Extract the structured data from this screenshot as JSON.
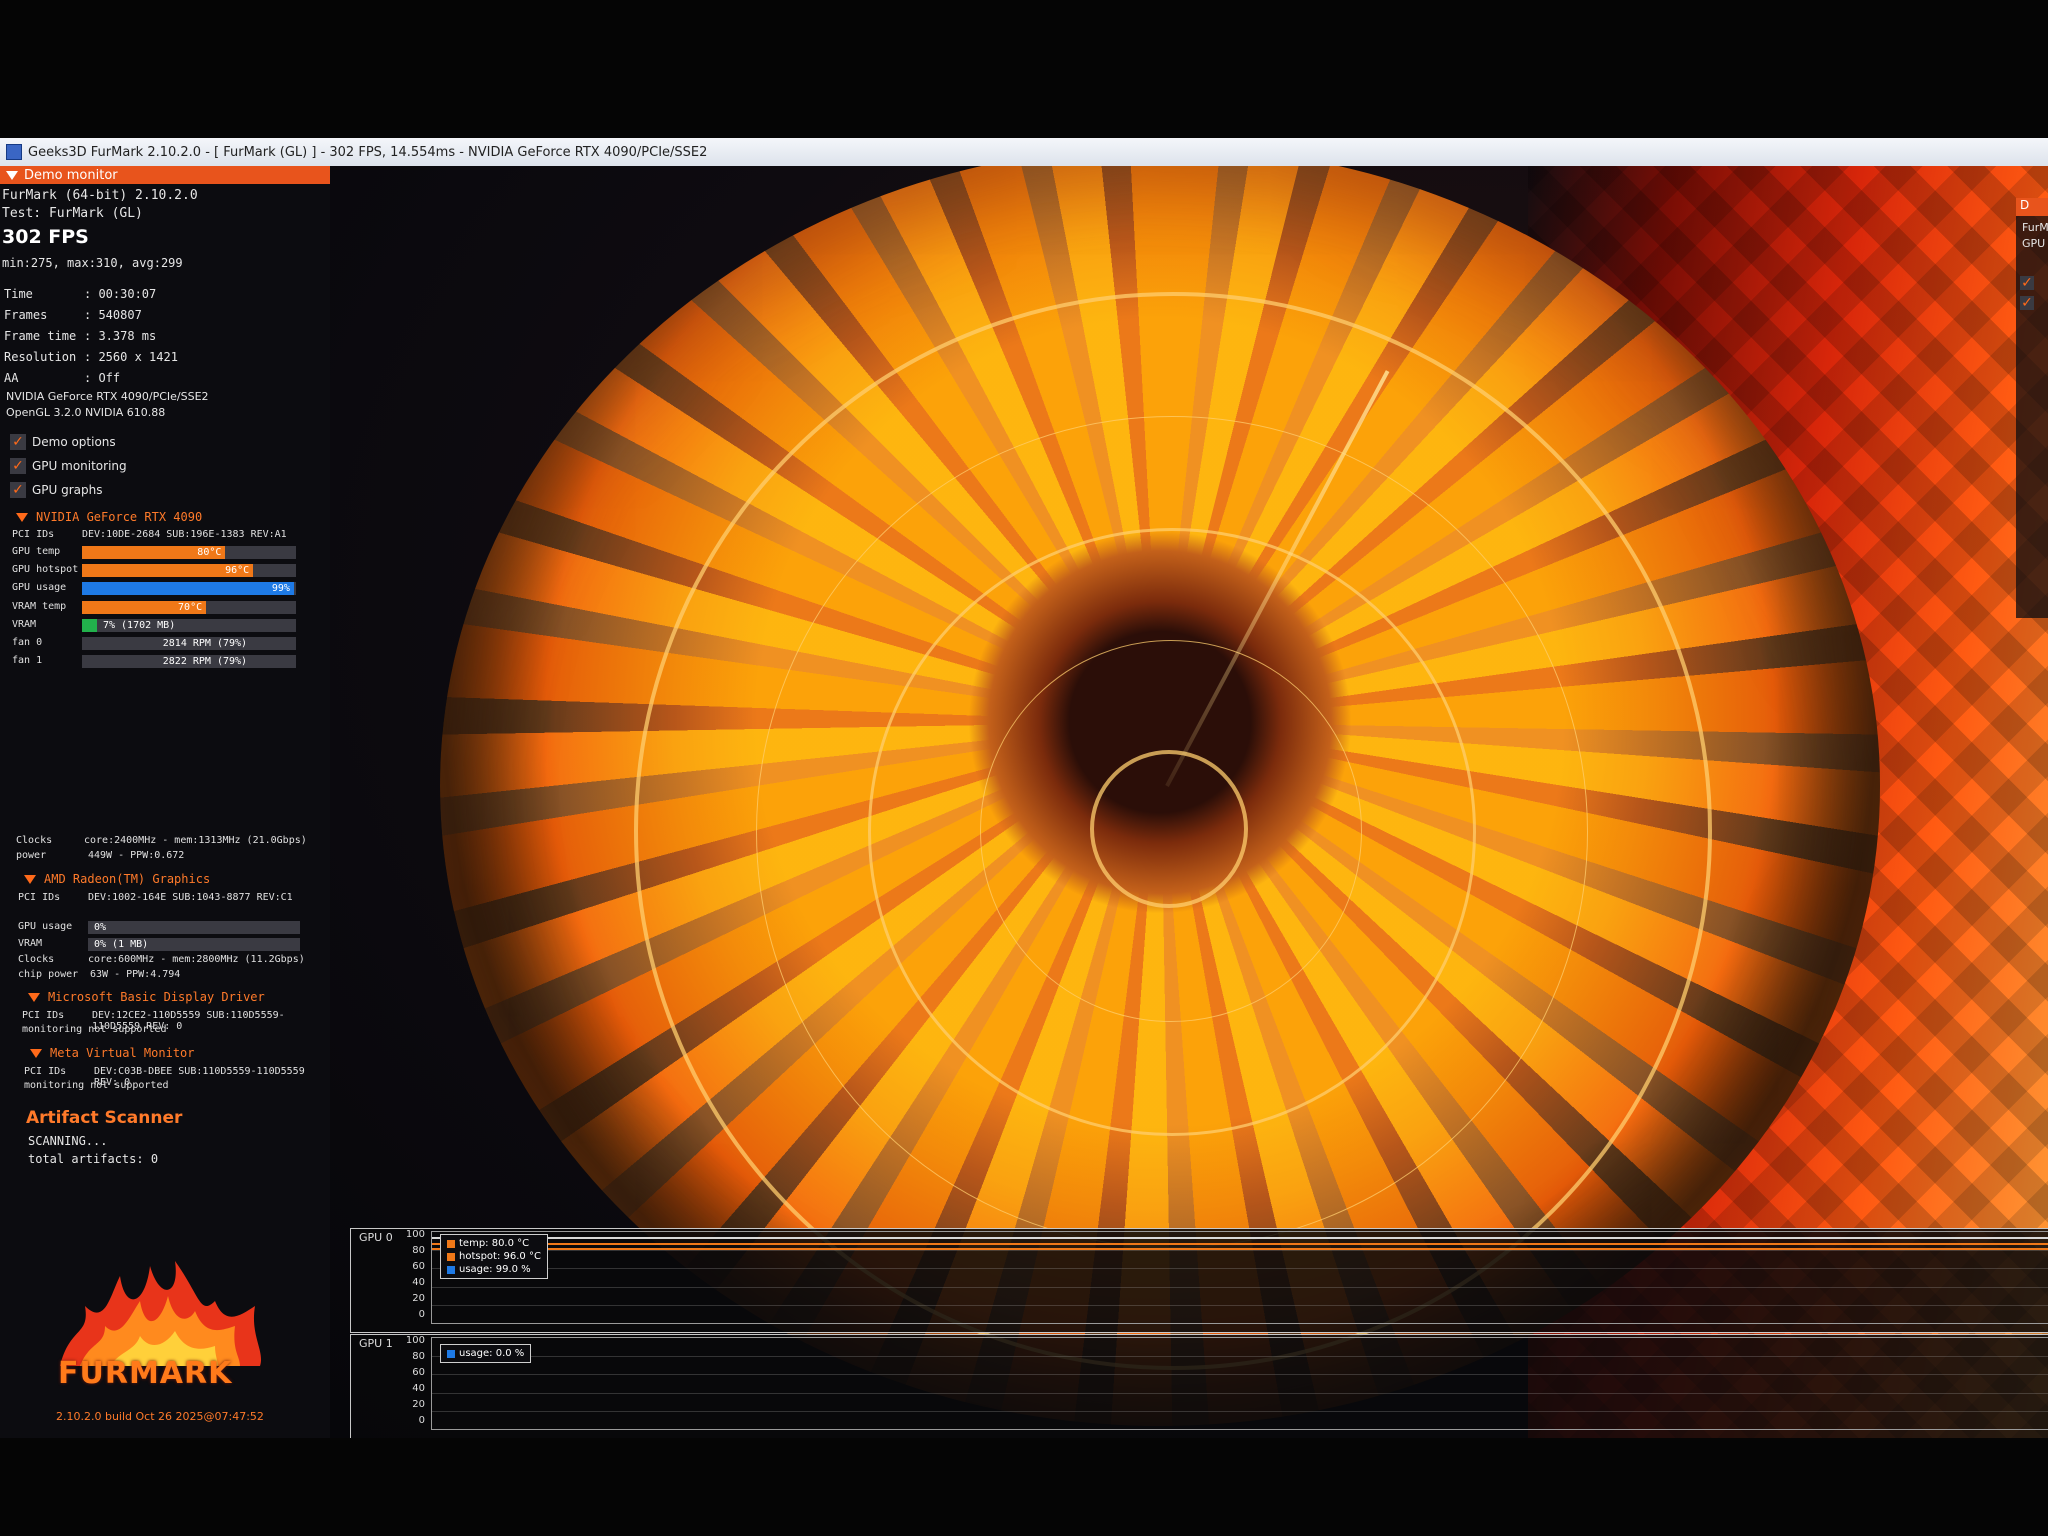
{
  "window": {
    "title": "Geeks3D FurMark 2.10.2.0 - [ FurMark (GL) ] - 302 FPS, 14.554ms - NVIDIA GeForce RTX 4090/PCIe/SSE2"
  },
  "panel": {
    "header": "Demo monitor",
    "app_line": "FurMark (64-bit) 2.10.2.0",
    "test_line": "Test: FurMark (GL)",
    "fps": "302 FPS",
    "fps_stats": "min:275, max:310, avg:299",
    "info": [
      {
        "label": "Time",
        "value": ": 00:30:07"
      },
      {
        "label": "Frames",
        "value": ": 540807"
      },
      {
        "label": "Frame time",
        "value": ": 3.378 ms"
      },
      {
        "label": "Resolution",
        "value": ": 2560 x 1421"
      },
      {
        "label": "AA",
        "value": ": Off"
      }
    ],
    "renderer": "NVIDIA GeForce RTX 4090/PCIe/SSE2",
    "opengl": "OpenGL 3.2.0 NVIDIA 610.88",
    "checkboxes": [
      "Demo options",
      "GPU monitoring",
      "GPU graphs"
    ]
  },
  "gpus": {
    "nvidia": {
      "name": "NVIDIA GeForce RTX 4090",
      "pci_label": "PCI IDs",
      "pci": "DEV:10DE-2684 SUB:196E-1383 REV:A1",
      "rows": [
        {
          "label": "GPU temp",
          "text": "80°C",
          "fill": 0.67,
          "color": "#f07818"
        },
        {
          "label": "GPU hotspot",
          "text": "96°C",
          "fill": 0.8,
          "color": "#f07818"
        },
        {
          "label": "GPU usage",
          "text": "99%",
          "fill": 0.99,
          "color": "#1e7ae6"
        },
        {
          "label": "VRAM temp",
          "text": "70°C",
          "fill": 0.58,
          "color": "#f07818"
        },
        {
          "label": "VRAM",
          "text": "7% (1702 MB)",
          "fill": 0.07,
          "color": "#22b14c"
        },
        {
          "label": "fan 0",
          "text": "2814 RPM (79%)",
          "fill": 0.79,
          "color": "#3a3a42"
        },
        {
          "label": "fan 1",
          "text": "2822 RPM (79%)",
          "fill": 0.79,
          "color": "#3a3a42"
        }
      ],
      "clocks_label": "Clocks",
      "clocks": "core:2400MHz - mem:1313MHz (21.0Gbps)",
      "power_label": "power",
      "power": "449W - PPW:0.672"
    },
    "amd": {
      "name": "AMD Radeon(TM) Graphics",
      "pci_label": "PCI IDs",
      "pci": "DEV:1002-164E SUB:1043-8877 REV:C1",
      "rows": [
        {
          "label": "GPU usage",
          "text": "0%",
          "fill": 0.0,
          "color": "#1e7ae6"
        },
        {
          "label": "VRAM",
          "text": "0% (1 MB)",
          "fill": 0.0,
          "color": "#22b14c"
        }
      ],
      "clocks_label": "Clocks",
      "clocks": "core:600MHz - mem:2800MHz (11.2Gbps)",
      "power_label": "chip power",
      "power": "63W - PPW:4.794"
    },
    "msbasic": {
      "name": "Microsoft Basic Display Driver",
      "pci_label": "PCI IDs",
      "pci": "DEV:12CE2-110D5559 SUB:110D5559-110D5559 REV: 0",
      "note": "monitoring not supported"
    },
    "meta": {
      "name": "Meta Virtual Monitor",
      "pci_label": "PCI IDs",
      "pci": "DEV:C03B-DBEE SUB:110D5559-110D5559 REV: 0",
      "note": "monitoring not supported"
    }
  },
  "artifact": {
    "title": "Artifact Scanner",
    "status": "SCANNING...",
    "count": "total artifacts: 0"
  },
  "logo": {
    "text": "FURMARK",
    "build": "2.10.2.0 build Oct 26 2025@07:47:52"
  },
  "graphs": [
    {
      "title": "GPU 0",
      "yticks": [
        "100",
        "80",
        "60",
        "40",
        "20",
        "0"
      ],
      "legend": [
        {
          "text": "temp: 80.0 °C",
          "color": "#f07818"
        },
        {
          "text": "hotspot: 96.0 °C",
          "color": "#f07818"
        },
        {
          "text": "usage: 99.0 %",
          "color": "#1e7ae6"
        }
      ]
    },
    {
      "title": "GPU 1",
      "yticks": [
        "100",
        "80",
        "60",
        "40",
        "20",
        "0"
      ],
      "legend": [
        {
          "text": "usage: 0.0 %",
          "color": "#1e7ae6"
        }
      ]
    }
  ],
  "right_panel": {
    "header": "D",
    "lines": [
      "FurM",
      "GPU"
    ]
  },
  "colors": {
    "accent": "#e8541c",
    "orange_text": "#ff7a2a"
  }
}
